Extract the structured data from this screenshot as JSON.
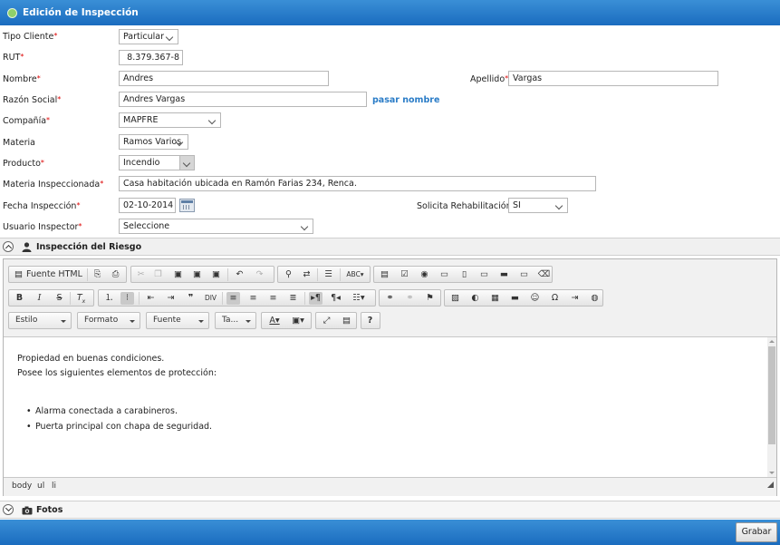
{
  "window": {
    "title": "Edición de Inspección"
  },
  "form": {
    "tipo_cliente": {
      "label": "Tipo Cliente",
      "value": "Particular"
    },
    "rut": {
      "label": "RUT",
      "value": "8.379.367-8"
    },
    "nombre": {
      "label": "Nombre",
      "value": "Andres"
    },
    "apellido": {
      "label": "Apellido",
      "value": "Vargas"
    },
    "razon_social": {
      "label": "Razón Social",
      "value": "Andres Vargas",
      "link": "pasar nombre"
    },
    "compania": {
      "label": "Compañía",
      "value": "MAPFRE"
    },
    "materia": {
      "label": "Materia",
      "value": "Ramos Varios"
    },
    "producto": {
      "label": "Producto",
      "value": "Incendio"
    },
    "materia_inspeccionada": {
      "label": "Materia Inspeccionada",
      "value": "Casa habitación ubicada en Ramón Farias 234, Renca."
    },
    "fecha_inspeccion": {
      "label": "Fecha Inspección",
      "value": "02-10-2014"
    },
    "solicita_rehabilitacion": {
      "label": "Solicita Rehabilitación",
      "value": "SI"
    },
    "usuario_inspector": {
      "label": "Usuario Inspector",
      "value": "Seleccione"
    },
    "required_mark": "*"
  },
  "section_riesgo": {
    "title": "Inspección del Riesgo"
  },
  "editor": {
    "toolbar": {
      "source_label": "Fuente HTML",
      "combos": {
        "style": "Estilo",
        "format": "Formato",
        "font": "Fuente",
        "size": "Ta..."
      },
      "help": "?"
    },
    "content": {
      "line1": "Propiedad en buenas condiciones.",
      "line2": "Posee los siguientes elementos de protección:",
      "items": [
        "Alarma conectada a carabineros.",
        "Puerta principal con chapa de seguridad."
      ]
    },
    "path": [
      "body",
      "ul",
      "li"
    ]
  },
  "section_fotos": {
    "title": "Fotos"
  },
  "footer": {
    "save_label": "Grabar"
  },
  "colors": {
    "header_blue": "#1f74c6",
    "link": "#2a7cc7",
    "required": "#dd0000"
  }
}
